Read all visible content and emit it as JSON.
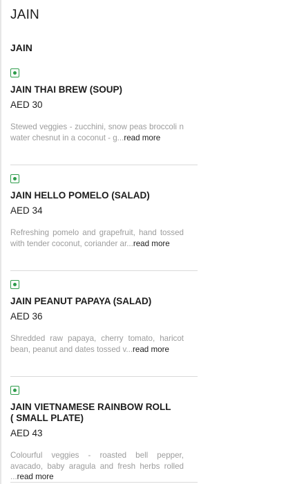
{
  "section": {
    "title": "JAIN",
    "subtitle": "JAIN"
  },
  "items": [
    {
      "name": "JAIN THAI BREW (SOUP)",
      "price": "AED 30",
      "desc_line1": "Stewed veggies - zucchini, snow peas broccoli n",
      "desc_line2": "water chesnut in a coconut - g...",
      "read_more": "read more",
      "veg_color": "#2e9c4b"
    },
    {
      "name": "JAIN HELLO POMELO (SALAD)",
      "price": "AED 34",
      "desc_line1": "Refreshing pomelo and grapefruit, hand tossed",
      "desc_line2": "with tender coconut, coriander ar...",
      "read_more": "read more",
      "veg_color": "#2e9c4b"
    },
    {
      "name": "JAIN PEANUT PAPAYA (SALAD)",
      "price": "AED 36",
      "desc_line1": "Shredded raw papaya, cherry tomato, haricot",
      "desc_line2": "bean, peanut and dates tossed v...",
      "read_more": "read more",
      "veg_color": "#2e9c4b"
    },
    {
      "name": "JAIN VIETNAMESE RAINBOW ROLL ( SMALL PLATE)",
      "price": "AED 43",
      "desc_line1": "Colourful veggies - roasted bell pepper, avacado,",
      "desc_line2": "baby aragula and fresh herbs rolled ...",
      "read_more": "read more",
      "veg_color": "#2e9c4b"
    }
  ]
}
